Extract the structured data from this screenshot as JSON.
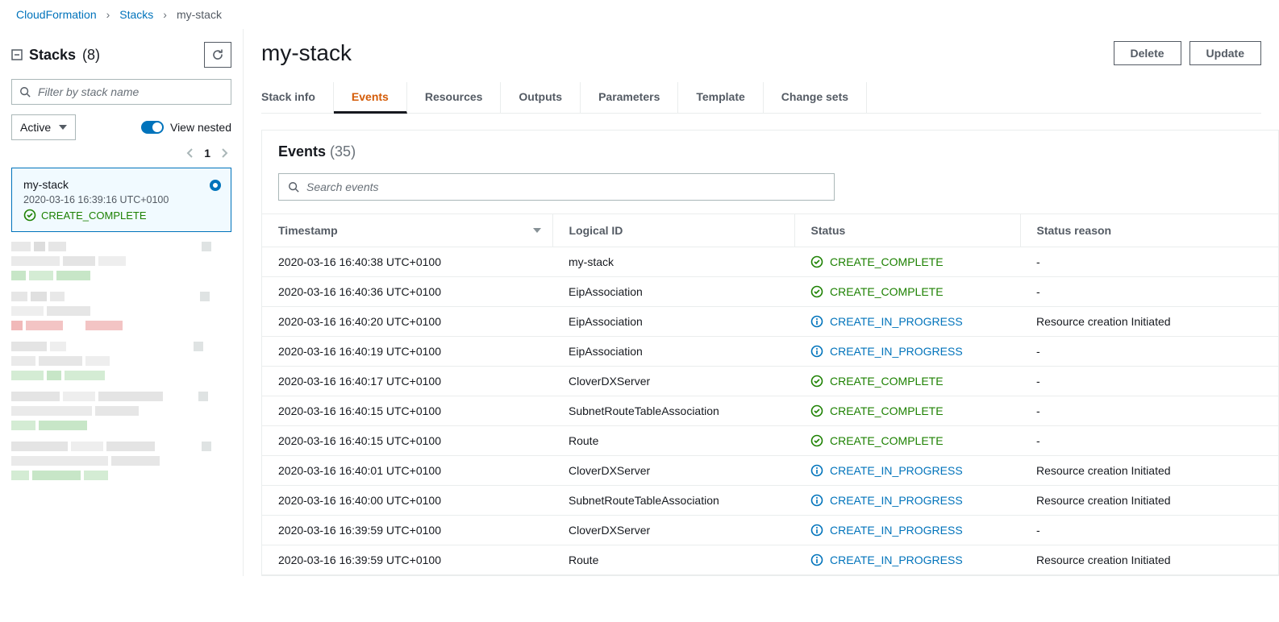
{
  "breadcrumb": {
    "root": "CloudFormation",
    "stacks": "Stacks",
    "current": "my-stack"
  },
  "sidebar": {
    "title": "Stacks",
    "count": "(8)",
    "filter_placeholder": "Filter by stack name",
    "active_label": "Active",
    "view_nested_label": "View nested",
    "page": "1",
    "selected_stack": {
      "name": "my-stack",
      "timestamp": "2020-03-16 16:39:16 UTC+0100",
      "status": "CREATE_COMPLETE"
    }
  },
  "main": {
    "title": "my-stack",
    "buttons": {
      "delete": "Delete",
      "update": "Update"
    },
    "tabs": [
      "Stack info",
      "Events",
      "Resources",
      "Outputs",
      "Parameters",
      "Template",
      "Change sets"
    ],
    "active_tab": "Events"
  },
  "events_panel": {
    "title": "Events",
    "count": "(35)",
    "search_placeholder": "Search events",
    "columns": [
      "Timestamp",
      "Logical ID",
      "Status",
      "Status reason"
    ],
    "rows": [
      {
        "timestamp": "2020-03-16 16:40:38 UTC+0100",
        "logical_id": "my-stack",
        "status": "CREATE_COMPLETE",
        "status_kind": "complete",
        "reason": "-"
      },
      {
        "timestamp": "2020-03-16 16:40:36 UTC+0100",
        "logical_id": "EipAssociation",
        "status": "CREATE_COMPLETE",
        "status_kind": "complete",
        "reason": "-"
      },
      {
        "timestamp": "2020-03-16 16:40:20 UTC+0100",
        "logical_id": "EipAssociation",
        "status": "CREATE_IN_PROGRESS",
        "status_kind": "progress",
        "reason": "Resource creation Initiated"
      },
      {
        "timestamp": "2020-03-16 16:40:19 UTC+0100",
        "logical_id": "EipAssociation",
        "status": "CREATE_IN_PROGRESS",
        "status_kind": "progress",
        "reason": "-"
      },
      {
        "timestamp": "2020-03-16 16:40:17 UTC+0100",
        "logical_id": "CloverDXServer",
        "status": "CREATE_COMPLETE",
        "status_kind": "complete",
        "reason": "-"
      },
      {
        "timestamp": "2020-03-16 16:40:15 UTC+0100",
        "logical_id": "SubnetRouteTableAssociation",
        "status": "CREATE_COMPLETE",
        "status_kind": "complete",
        "reason": "-"
      },
      {
        "timestamp": "2020-03-16 16:40:15 UTC+0100",
        "logical_id": "Route",
        "status": "CREATE_COMPLETE",
        "status_kind": "complete",
        "reason": "-"
      },
      {
        "timestamp": "2020-03-16 16:40:01 UTC+0100",
        "logical_id": "CloverDXServer",
        "status": "CREATE_IN_PROGRESS",
        "status_kind": "progress",
        "reason": "Resource creation Initiated"
      },
      {
        "timestamp": "2020-03-16 16:40:00 UTC+0100",
        "logical_id": "SubnetRouteTableAssociation",
        "status": "CREATE_IN_PROGRESS",
        "status_kind": "progress",
        "reason": "Resource creation Initiated"
      },
      {
        "timestamp": "2020-03-16 16:39:59 UTC+0100",
        "logical_id": "CloverDXServer",
        "status": "CREATE_IN_PROGRESS",
        "status_kind": "progress",
        "reason": "-"
      },
      {
        "timestamp": "2020-03-16 16:39:59 UTC+0100",
        "logical_id": "Route",
        "status": "CREATE_IN_PROGRESS",
        "status_kind": "progress",
        "reason": "Resource creation Initiated"
      }
    ]
  }
}
